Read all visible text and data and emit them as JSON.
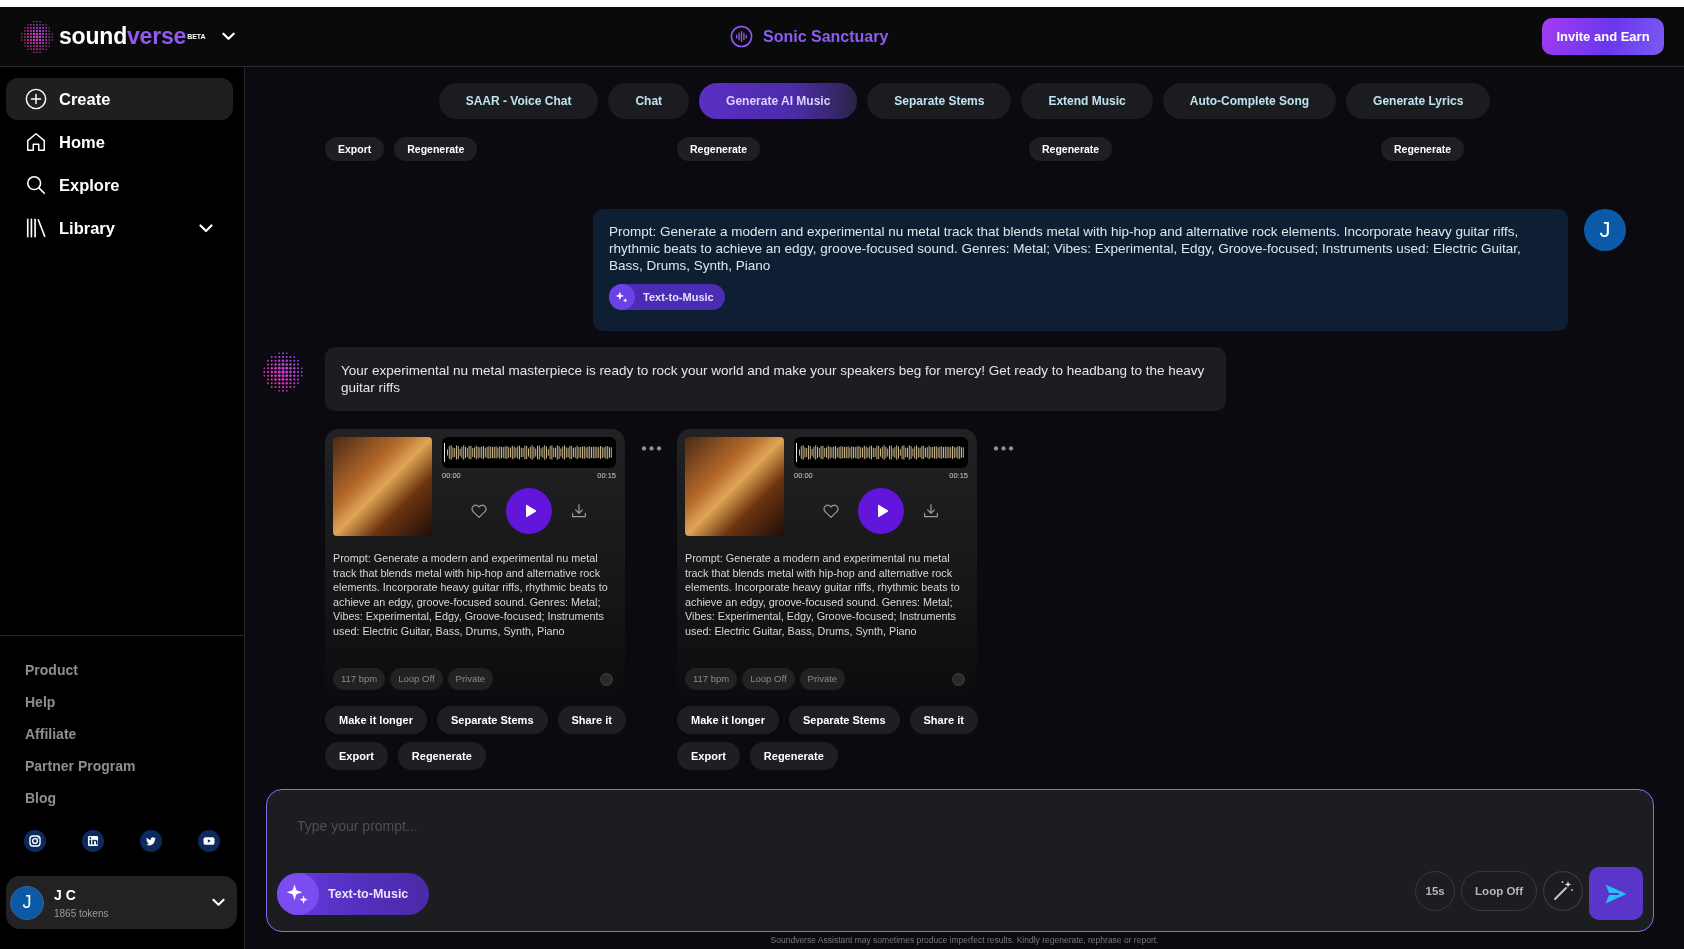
{
  "header": {
    "logo": {
      "parts": [
        "sound",
        "verse"
      ],
      "badge": "BETA"
    },
    "workspace": "Sonic Sanctuary",
    "invite_button": "Invite and Earn"
  },
  "sidebar": {
    "items": [
      {
        "label": "Create",
        "kind": "link",
        "selected": true
      },
      {
        "label": "Home",
        "kind": "link",
        "selected": false
      },
      {
        "label": "Explore",
        "kind": "link",
        "selected": false
      },
      {
        "label": "Library",
        "kind": "group",
        "selected": false,
        "expanded": false
      }
    ],
    "footer_links": [
      "Product",
      "Help",
      "Affiliate",
      "Partner Program",
      "Blog"
    ],
    "user": {
      "avatar": "J",
      "name": "J C",
      "tokens": "1865 tokens"
    }
  },
  "tabs": [
    {
      "label": "SAAR - Voice Chat",
      "selected": false
    },
    {
      "label": "Chat",
      "selected": false
    },
    {
      "label": "Generate AI Music",
      "selected": true
    },
    {
      "label": "Separate Stems",
      "selected": false
    },
    {
      "label": "Extend Music",
      "selected": false
    },
    {
      "label": "Auto-Complete Song",
      "selected": false
    },
    {
      "label": "Generate Lyrics",
      "selected": false
    }
  ],
  "previous_actions": [
    [
      "Export",
      "Regenerate"
    ],
    [
      "Regenerate"
    ],
    [
      "Regenerate"
    ],
    [
      "Regenerate"
    ]
  ],
  "messages": [
    {
      "kind": "user",
      "text": "Prompt: Generate a modern and experimental nu metal track that blends metal with hip-hop and alternative rock elements. Incorporate heavy guitar riffs, rhythmic beats to achieve an edgy, groove-focused sound. Genres: Metal; Vibes: Experimental, Edgy, Groove-focused; Instruments used: Electric Guitar, Bass, Drums, Synth, Piano",
      "mode": "Text-to-Music",
      "avatar": "J"
    },
    {
      "kind": "assistant",
      "text": "Your experimental nu metal masterpiece is ready to rock your world and make your speakers beg for mercy! Get ready to headbang to the heavy guitar riffs"
    }
  ],
  "tracks": [
    {
      "time_start": "00:00",
      "time_end": "00:15",
      "liked": false,
      "prompt": "Prompt: Generate a modern and experimental nu metal track that blends metal with hip-hop and alternative rock elements. Incorporate heavy guitar riffs, rhythmic beats to achieve an edgy, groove-focused sound. Genres: Metal; Vibes: Experimental, Edgy, Groove-focused; Instruments used: Electric Guitar, Bass, Drums, Synth, Piano",
      "tags": [
        "117 bpm",
        "Loop Off",
        "Private"
      ],
      "actions": [
        [
          "Make it longer",
          "Separate Stems",
          "Share it"
        ],
        [
          "Export",
          "Regenerate"
        ]
      ]
    },
    {
      "time_start": "00:00",
      "time_end": "00:15",
      "liked": false,
      "prompt": "Prompt: Generate a modern and experimental nu metal track that blends metal with hip-hop and alternative rock elements. Incorporate heavy guitar riffs, rhythmic beats to achieve an edgy, groove-focused sound. Genres: Metal; Vibes: Experimental, Edgy, Groove-focused; Instruments used: Electric Guitar, Bass, Drums, Synth, Piano",
      "tags": [
        "117 bpm",
        "Loop Off",
        "Private"
      ],
      "actions": [
        [
          "Make it longer",
          "Separate Stems",
          "Share it"
        ],
        [
          "Export",
          "Regenerate"
        ]
      ]
    }
  ],
  "composer": {
    "placeholder": "Type your prompt...",
    "mode": "Text-to-Music",
    "duration": "15s",
    "loop": "Loop Off"
  },
  "disclaimer": "Soundverse Assistant may sometimes produce imperfect results. Kindly regenerate, rephrase or report."
}
